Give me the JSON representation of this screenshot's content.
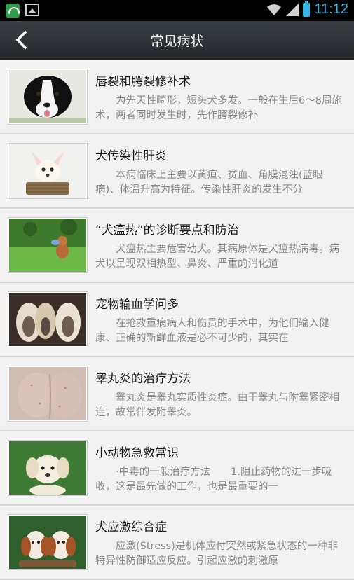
{
  "status": {
    "time": "11:12"
  },
  "header": {
    "title": "常见病状",
    "back_icon": "back-chevron-icon"
  },
  "items": [
    {
      "title": "唇裂和腭裂修补术",
      "desc": "　　为先天性畸形，短头犬多发。一般在生后6～8周施术，两者同时发生时，先作腭裂修补",
      "thumb": "border-collie-puppy"
    },
    {
      "title": "犬传染性肝炎",
      "desc": "　　本病临床上主要以黄疸、贫血、角膜混浊(蓝眼病)、体温升高为特征。传染性肝炎的发生不分",
      "thumb": "white-chihuahua-in-basket"
    },
    {
      "title": "“犬瘟热”的诊断要点和防治",
      "desc": "　　犬瘟热主要危害幼犬。其病原体是犬瘟热病毒。病犬以呈现双相热型、鼻炎、严重的消化道",
      "thumb": "poodle-on-grass"
    },
    {
      "title": "宠物输血学问多",
      "desc": "　　在抢救重病病人和伤员的手术中，为他们输入健康、正确的新鲜血液是必不可少的，其实在",
      "thumb": "chinese-crested-dogs"
    },
    {
      "title": "睾丸炎的治疗方法",
      "desc": "　　睾丸炎是睾丸实质性炎症。由于睾丸与附睾紧密相连，故常伴发附睾炎。",
      "thumb": "skin-closeup"
    },
    {
      "title": "小动物急救常识",
      "desc": "　　·中毒的一般治疗方法　　1.阻止药物的进一步吸收，这是最先做的工作，也是最重要的一",
      "thumb": "labrador-puppy"
    },
    {
      "title": "犬应激综合症",
      "desc": "　　应激(Stress)是机体应付突然或紧急状态的一种非特异性防御适应反应。引起应激的刺激原",
      "thumb": "basset-hound-puppies"
    }
  ]
}
